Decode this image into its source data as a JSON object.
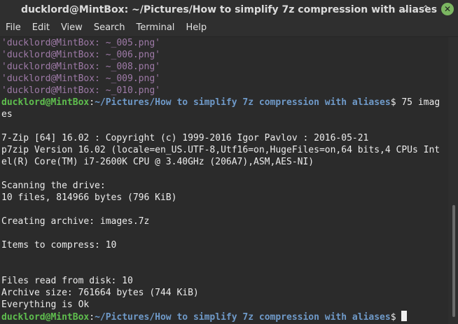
{
  "window": {
    "title": "ducklord@MintBox: ~/Pictures/How to simplify 7z compression with aliases",
    "controls": {
      "minimize": "⌄",
      "maximize": "⌃",
      "close": "✕"
    }
  },
  "menu": {
    "items": [
      "File",
      "Edit",
      "View",
      "Search",
      "Terminal",
      "Help"
    ]
  },
  "terminal": {
    "prior_lines": [
      "'ducklord@MintBox: ~_005.png'",
      "'ducklord@MintBox: ~_006.png'",
      "'ducklord@MintBox: ~_008.png'",
      "'ducklord@MintBox: ~_009.png'",
      "'ducklord@MintBox: ~_010.png'"
    ],
    "prompt_user": "ducklord@MintBox",
    "prompt_sep": ":",
    "prompt_path": "~/Pictures/How to simplify 7z compression with aliases",
    "prompt_dollar": "$ ",
    "command_line1": "75 imag",
    "command_line2": "es",
    "output": [
      "",
      "7-Zip [64] 16.02 : Copyright (c) 1999-2016 Igor Pavlov : 2016-05-21",
      "p7zip Version 16.02 (locale=en_US.UTF-8,Utf16=on,HugeFiles=on,64 bits,4 CPUs Int",
      "el(R) Core(TM) i7-2600K CPU @ 3.40GHz (206A7),ASM,AES-NI)",
      "",
      "Scanning the drive:",
      "10 files, 814966 bytes (796 KiB)",
      "",
      "Creating archive: images.7z",
      "",
      "Items to compress: 10",
      "",
      "",
      "Files read from disk: 10",
      "Archive size: 761664 bytes (744 KiB)",
      "Everything is Ok"
    ]
  },
  "colors": {
    "background": "#2b2b2b",
    "prompt_user": "#5fbf4e",
    "prompt_path": "#6f9ac9",
    "dim_text": "#9e7aa7",
    "close_button": "#7bb661"
  }
}
